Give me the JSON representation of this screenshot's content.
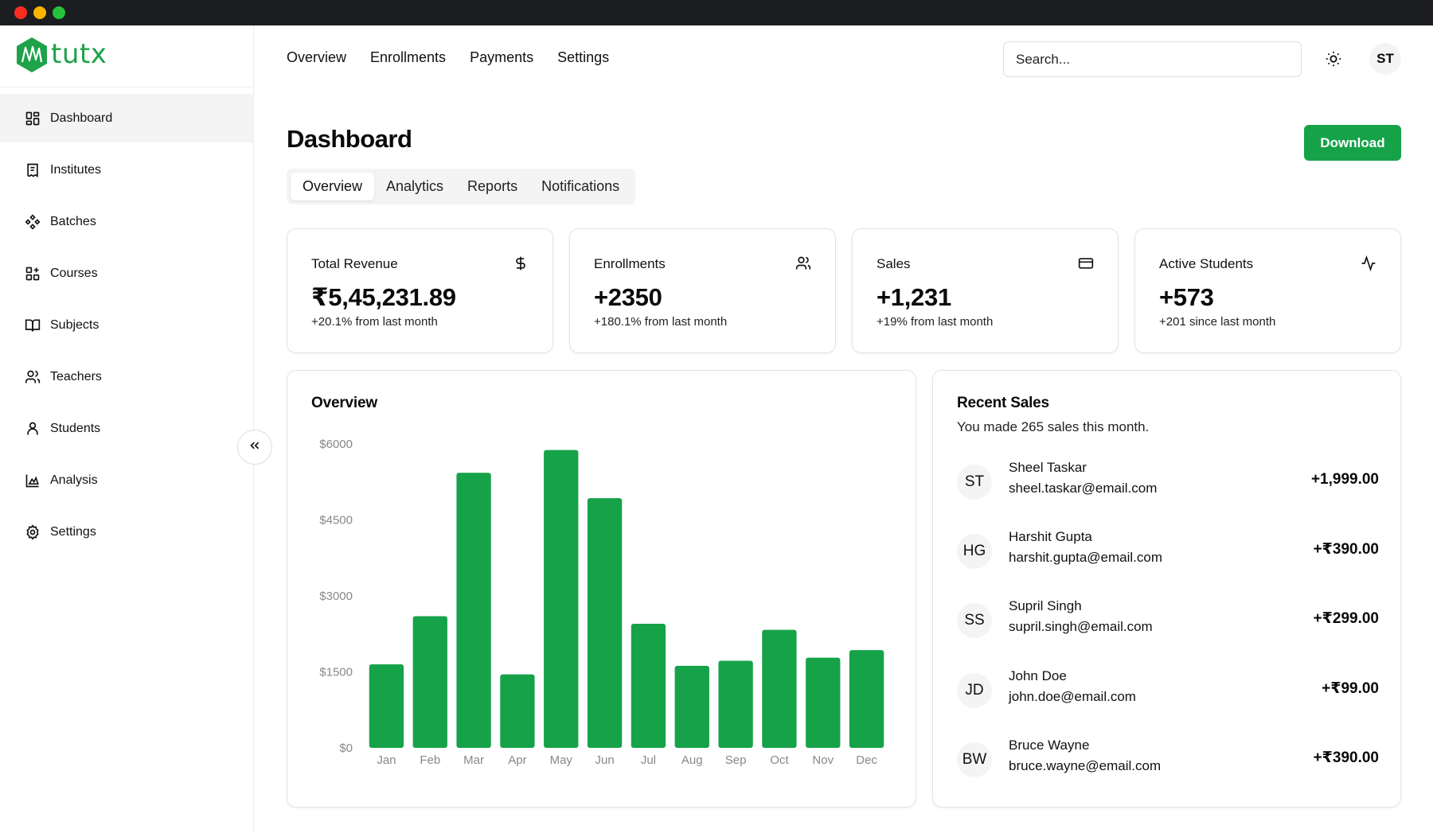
{
  "app": {
    "logo_text": "tutx"
  },
  "sidebar": {
    "items": [
      {
        "label": "Dashboard",
        "icon": "layout-dashboard-icon"
      },
      {
        "label": "Institutes",
        "icon": "receipt-icon"
      },
      {
        "label": "Batches",
        "icon": "components-icon"
      },
      {
        "label": "Courses",
        "icon": "grid-plus-icon"
      },
      {
        "label": "Subjects",
        "icon": "book-open-icon"
      },
      {
        "label": "Teachers",
        "icon": "users-icon"
      },
      {
        "label": "Students",
        "icon": "user-icon"
      },
      {
        "label": "Analysis",
        "icon": "area-chart-icon"
      },
      {
        "label": "Settings",
        "icon": "gear-icon"
      }
    ],
    "active_index": 0
  },
  "topnav": {
    "links": [
      "Overview",
      "Enrollments",
      "Payments",
      "Settings"
    ]
  },
  "search": {
    "placeholder": "Search..."
  },
  "user": {
    "initials": "ST"
  },
  "page": {
    "title": "Dashboard",
    "download_label": "Download"
  },
  "tabs": {
    "items": [
      "Overview",
      "Analytics",
      "Reports",
      "Notifications"
    ],
    "active_index": 0
  },
  "stats": [
    {
      "label": "Total Revenue",
      "value": "₹5,45,231.89",
      "sub": "+20.1% from last month",
      "icon": "dollar-icon"
    },
    {
      "label": "Enrollments",
      "value": "+2350",
      "sub": "+180.1% from last month",
      "icon": "users-icon"
    },
    {
      "label": "Sales",
      "value": "+1,231",
      "sub": "+19% from last month",
      "icon": "credit-card-icon"
    },
    {
      "label": "Active Students",
      "value": "+573",
      "sub": "+201 since last month",
      "icon": "activity-icon"
    }
  ],
  "chart_data": {
    "type": "bar",
    "title": "Overview",
    "categories": [
      "Jan",
      "Feb",
      "Mar",
      "Apr",
      "May",
      "Jun",
      "Jul",
      "Aug",
      "Sep",
      "Oct",
      "Nov",
      "Dec"
    ],
    "values": [
      1650,
      2600,
      5430,
      1450,
      5880,
      4930,
      2450,
      1620,
      1720,
      2330,
      1780,
      1930
    ],
    "y_ticks": [
      "$0",
      "$1500",
      "$3000",
      "$4500",
      "$6000"
    ],
    "ylim": [
      0,
      6000
    ],
    "color": "#16a249",
    "grid": false
  },
  "recent_sales": {
    "title": "Recent Sales",
    "subtitle": "You made 265 sales this month.",
    "items": [
      {
        "initials": "ST",
        "name": "Sheel Taskar",
        "email": "sheel.taskar@email.com",
        "amount": "+1,999.00"
      },
      {
        "initials": "HG",
        "name": "Harshit Gupta",
        "email": "harshit.gupta@email.com",
        "amount": "+₹390.00"
      },
      {
        "initials": "SS",
        "name": "Supril Singh",
        "email": "supril.singh@email.com",
        "amount": "+₹299.00"
      },
      {
        "initials": "JD",
        "name": "John Doe",
        "email": "john.doe@email.com",
        "amount": "+₹99.00"
      },
      {
        "initials": "BW",
        "name": "Bruce Wayne",
        "email": "bruce.wayne@email.com",
        "amount": "+₹390.00"
      }
    ]
  },
  "colors": {
    "brand": "#16a249",
    "traffic_red": "#fe2d22",
    "traffic_yellow": "#f9b600",
    "traffic_green": "#26c33a"
  }
}
